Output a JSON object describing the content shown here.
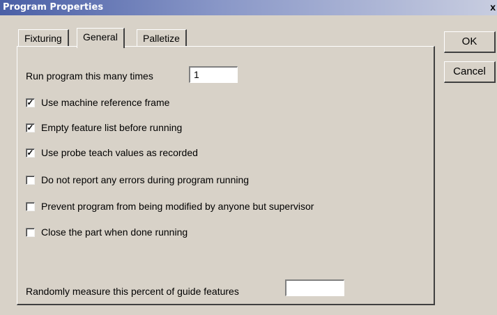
{
  "window": {
    "title": "Program Properties",
    "close_glyph": "x"
  },
  "tabs": [
    {
      "label": "Fixturing",
      "active": false
    },
    {
      "label": "General",
      "active": true
    },
    {
      "label": "Palletize",
      "active": false
    }
  ],
  "buttons": {
    "ok": "OK",
    "cancel": "Cancel"
  },
  "general": {
    "run_times_label": "Run program this many times",
    "run_times_value": "1",
    "options": [
      {
        "label": "Use machine reference frame",
        "checked": true
      },
      {
        "label": "Empty feature list before running",
        "checked": true
      },
      {
        "label": "Use probe teach values as recorded",
        "checked": true
      },
      {
        "label": "Do not report any errors during program running",
        "checked": false
      },
      {
        "label": "Prevent program from being modified by anyone but supervisor",
        "checked": false
      },
      {
        "label": "Close the part when done running",
        "checked": false
      }
    ],
    "random_label": "Randomly measure this percent of guide features",
    "random_value": ""
  }
}
